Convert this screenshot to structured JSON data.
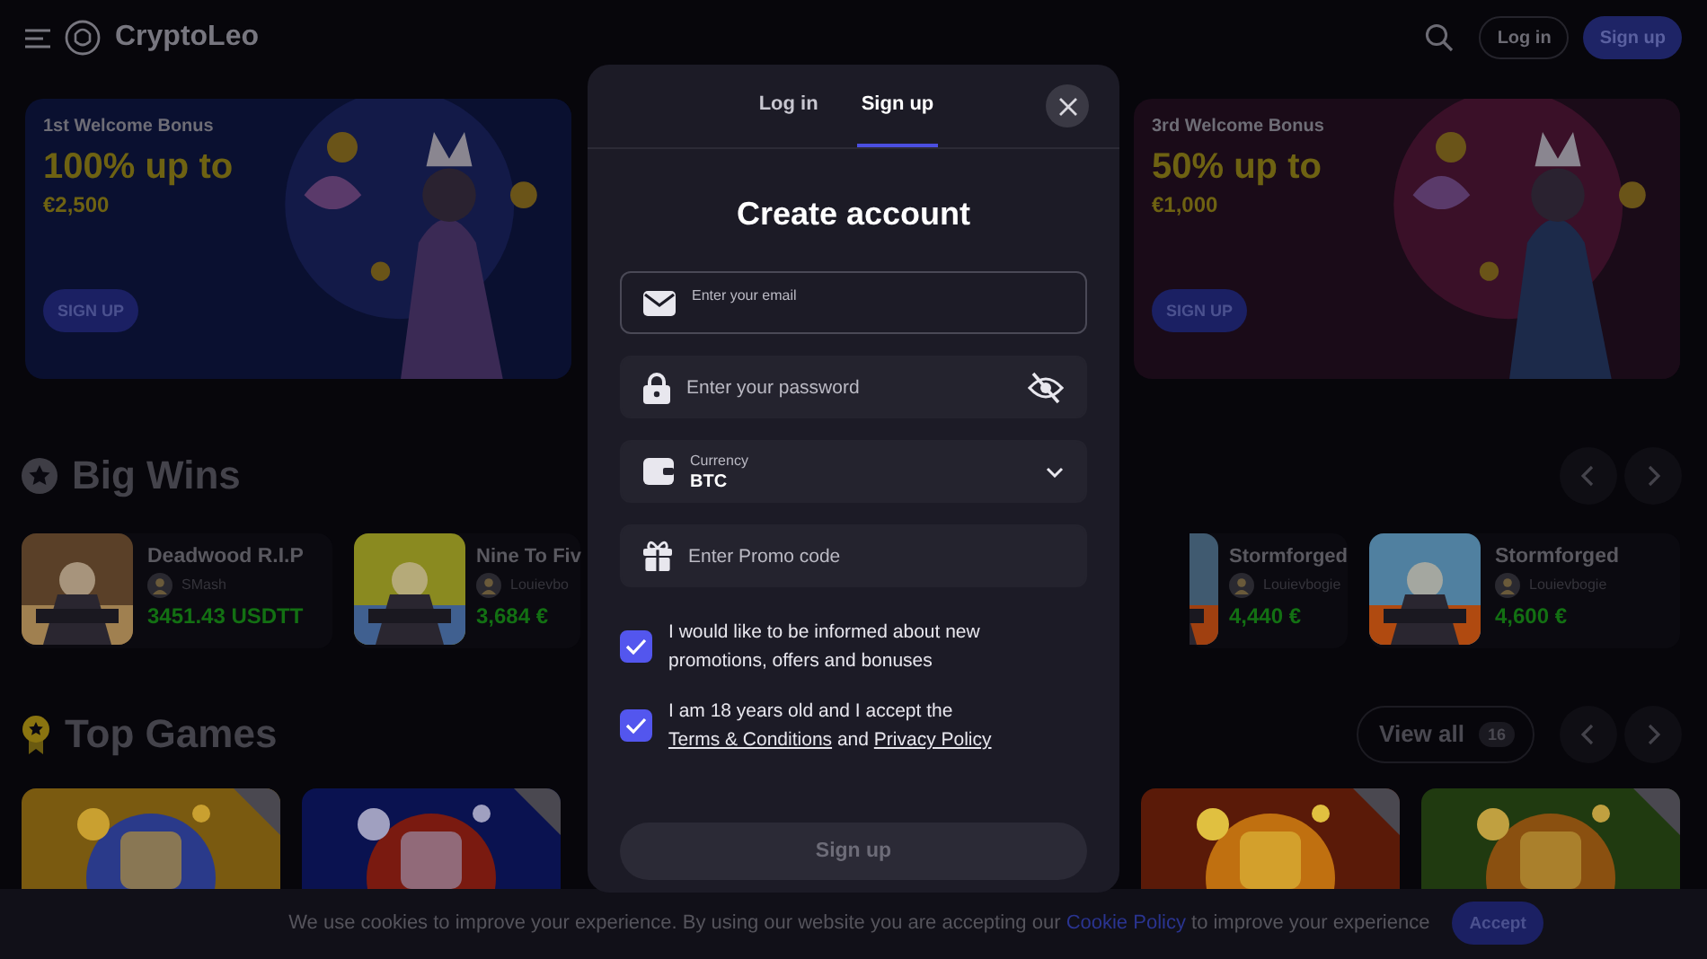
{
  "header": {
    "logo": "CryptoLeo",
    "login": "Log in",
    "signup": "Sign up"
  },
  "banners": [
    {
      "kicker": "1st Welcome Bonus",
      "headline": "100% up to",
      "amount": "€2,500",
      "button": "SIGN UP"
    },
    {
      "kicker": "3rd Welcome Bonus",
      "headline": "50% up to",
      "amount": "€1,000",
      "button": "SIGN UP"
    }
  ],
  "big_wins": {
    "title": "Big Wins",
    "cards": [
      {
        "game": "Deadwood R.I.P",
        "user": "SMash",
        "amount": "3451.43 USDTT"
      },
      {
        "game": "Nine To Fiv",
        "user": "Louievbo",
        "amount": "3,684 €"
      },
      {
        "game": "Stormforged",
        "user": "Louievbogie",
        "amount": "4,440 €"
      },
      {
        "game": "Stormforged",
        "user": "Louievbogie",
        "amount": "4,600 €"
      }
    ]
  },
  "top_games": {
    "title": "Top Games",
    "view_all": "View all",
    "count": "16"
  },
  "modal": {
    "tabs": [
      {
        "label": "Log in",
        "selected": false
      },
      {
        "label": "Sign up",
        "selected": true
      }
    ],
    "title": "Create account",
    "fields": [
      {
        "kind": "email",
        "label": "Enter your email",
        "focused": true
      },
      {
        "kind": "password",
        "placeholder": "Enter your password"
      },
      {
        "kind": "select",
        "label": "Currency",
        "value": "BTC"
      },
      {
        "kind": "promo",
        "placeholder": "Enter Promo code"
      }
    ],
    "consents": [
      {
        "checked": true,
        "parts": [
          {
            "kind": "text",
            "text": "I would like to be informed about new promotions, offers and bonuses"
          }
        ]
      },
      {
        "checked": true,
        "parts": [
          {
            "kind": "text",
            "text": "I am 18 years old and I accept the "
          },
          {
            "kind": "link",
            "text": "Terms & Conditions"
          },
          {
            "kind": "text",
            "text": " and "
          },
          {
            "kind": "link",
            "text": "Privacy Policy"
          }
        ]
      }
    ],
    "submit": {
      "label": "Sign up",
      "disabled": true
    }
  },
  "cookie": {
    "parts": [
      {
        "kind": "text",
        "text": "We use cookies to improve your experience. By using our website you are accepting our "
      },
      {
        "kind": "link",
        "text": "Cookie Policy"
      },
      {
        "kind": "text",
        "text": " to improve your experience"
      }
    ],
    "button": "Accept"
  }
}
